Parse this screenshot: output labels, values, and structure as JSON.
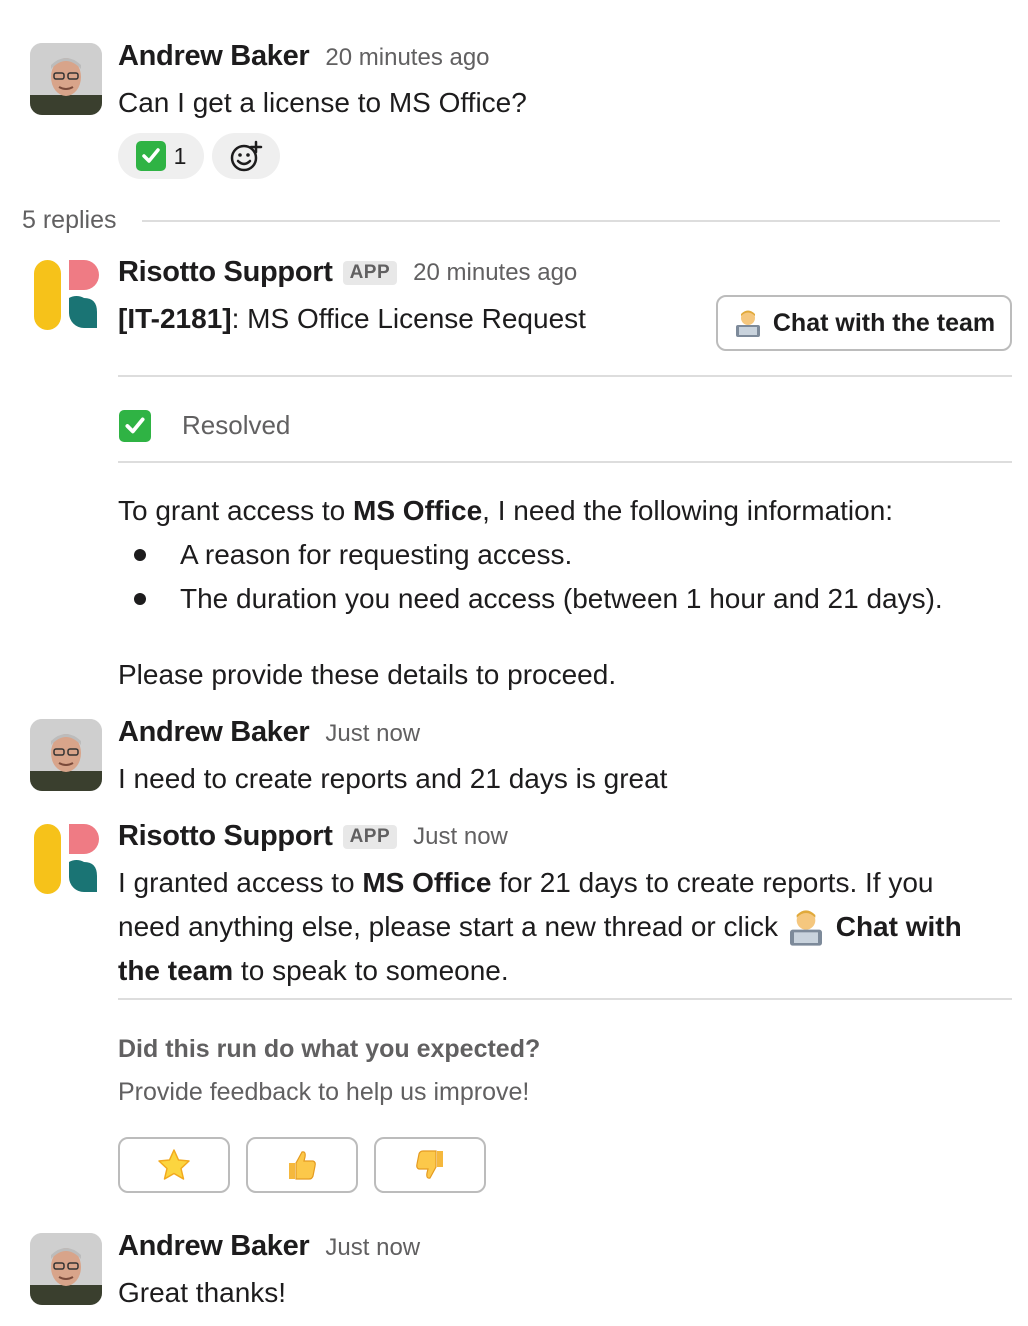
{
  "messages": [
    {
      "author": "Andrew Baker",
      "time": "20 minutes ago",
      "text": "Can I get a license to MS Office?",
      "reactions": [
        {
          "emoji": "check-mark-emoji",
          "count": "1"
        }
      ]
    }
  ],
  "thread": {
    "replies_label": "5 replies"
  },
  "bot1": {
    "author": "Risotto Support",
    "badge": "APP",
    "time": "20 minutes ago",
    "ticket_id": "[IT-2181]",
    "ticket_title": ": MS Office License Request",
    "chat_button": "Chat with the team",
    "status": "Resolved",
    "intro_pre": "To grant access to ",
    "intro_bold": "MS Office",
    "intro_post": ", I need the following information:",
    "bullets": [
      "A reason for requesting access.",
      "The duration you need access (between 1 hour and 21 days)."
    ],
    "closing": "Please provide these details to proceed."
  },
  "reply1": {
    "author": "Andrew Baker",
    "time": "Just now",
    "text": "I need to create reports and 21 days is great"
  },
  "bot2": {
    "author": "Risotto Support",
    "badge": "APP",
    "time": "Just now",
    "line1_pre": "I granted access to ",
    "line1_bold": "MS Office",
    "line1_post": " for 21 days to create reports. If you",
    "line2_pre": "need anything else, please start a new thread or click ",
    "line2_bold": "Chat with",
    "line3_bold": "the team",
    "line3_post": " to speak to someone.",
    "feedback_title": "Did this run do what you expected?",
    "feedback_subtitle": "Provide feedback to help us improve!",
    "feedback_buttons": [
      "star-icon",
      "thumbs-up-icon",
      "thumbs-down-icon"
    ]
  },
  "reply2": {
    "author": "Andrew Baker",
    "time": "Just now",
    "text": "Great thanks!"
  },
  "colors": {
    "bot_yellow": "#f6c21a",
    "bot_pink": "#ef7b84",
    "bot_teal": "#1a7474",
    "check_green": "#2fb344"
  }
}
